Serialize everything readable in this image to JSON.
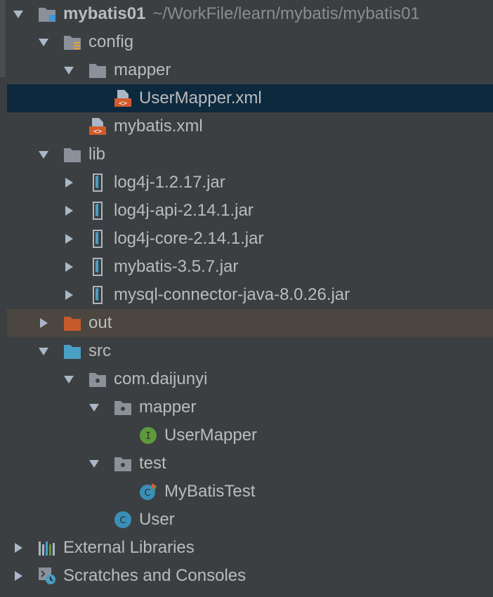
{
  "project": {
    "name": "mybatis01",
    "path": "~/WorkFile/learn/mybatis/mybatis01"
  },
  "tree": {
    "config": "config",
    "mapper_folder": "mapper",
    "user_mapper_xml": "UserMapper.xml",
    "mybatis_xml": "mybatis.xml",
    "lib": "lib",
    "jars": [
      "log4j-1.2.17.jar",
      "log4j-api-2.14.1.jar",
      "log4j-core-2.14.1.jar",
      "mybatis-3.5.7.jar",
      "mysql-connector-java-8.0.26.jar"
    ],
    "out": "out",
    "src": "src",
    "package": "com.daijunyi",
    "mapper_pkg": "mapper",
    "user_mapper": "UserMapper",
    "test_pkg": "test",
    "mybatis_test": "MyBatisTest",
    "user": "User",
    "external_libraries": "External Libraries",
    "scratches": "Scratches and Consoles"
  },
  "colors": {
    "background": "#3c3f41",
    "selection": "#0d293e",
    "excluded": "#4b4740",
    "folder": "#8b9199",
    "source_folder": "#4a9fc4",
    "excluded_folder": "#c55a2a",
    "xml_icon": "#d35a2c",
    "interface_icon": "#5c9a3b",
    "class_icon": "#3a8fb7"
  }
}
